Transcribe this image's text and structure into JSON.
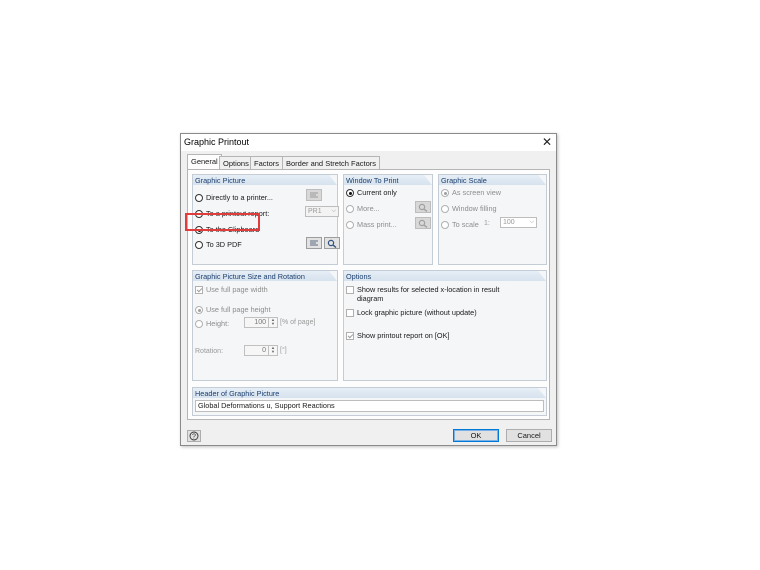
{
  "window": {
    "title": "Graphic Printout",
    "close_glyph": "✕"
  },
  "tabs": [
    {
      "label": "General",
      "active": true
    },
    {
      "label": "Options",
      "active": false
    },
    {
      "label": "Factors",
      "active": false
    },
    {
      "label": "Border and Stretch Factors",
      "active": false
    }
  ],
  "graphic_picture": {
    "header": "Graphic Picture",
    "options": [
      {
        "label": "Directly to a printer...",
        "selected": false,
        "icon": "printer-settings-icon"
      },
      {
        "label": "To a printout report:",
        "selected": false,
        "report_value": "PR1"
      },
      {
        "label": "To the Clipboard",
        "selected": true
      },
      {
        "label": "To 3D PDF",
        "selected": false,
        "icons": [
          "settings-icon",
          "preview-icon"
        ]
      }
    ]
  },
  "window_to_print": {
    "header": "Window To Print",
    "options": [
      {
        "label": "Current only",
        "selected": true
      },
      {
        "label": "More...",
        "selected": false,
        "enabled": false
      },
      {
        "label": "Mass print...",
        "selected": false,
        "enabled": false
      }
    ]
  },
  "graphic_scale": {
    "header": "Graphic Scale",
    "options": [
      {
        "label": "As screen view",
        "selected": true,
        "enabled": false
      },
      {
        "label": "Window filling",
        "selected": false,
        "enabled": false
      },
      {
        "label": "To scale",
        "selected": false,
        "enabled": false
      }
    ],
    "scale_prefix": "1:",
    "scale_value": "100"
  },
  "size_rotation": {
    "header": "Graphic Picture Size and Rotation",
    "use_full_page_width": "Use full page width",
    "use_full_page_height": "Use full page height",
    "height_label": "Height:",
    "height_value": "100",
    "height_unit": "[% of page]",
    "rotation_label": "Rotation:",
    "rotation_value": "0",
    "rotation_unit": "[°]"
  },
  "options_group": {
    "header": "Options",
    "show_results_line1": "Show results for selected x-location in result",
    "show_results_line2": "diagram",
    "lock_graphic": "Lock graphic picture (without update)",
    "show_printout_report": "Show printout report on [OK]"
  },
  "header_of_picture": {
    "header": "Header of Graphic Picture",
    "value": "Global Deformations u, Support Reactions"
  },
  "buttons": {
    "ok": "OK",
    "cancel": "Cancel"
  },
  "colors": {
    "accent": "#0078d7",
    "highlight": "#e23b3b",
    "group_header": "#1b3f6e"
  }
}
